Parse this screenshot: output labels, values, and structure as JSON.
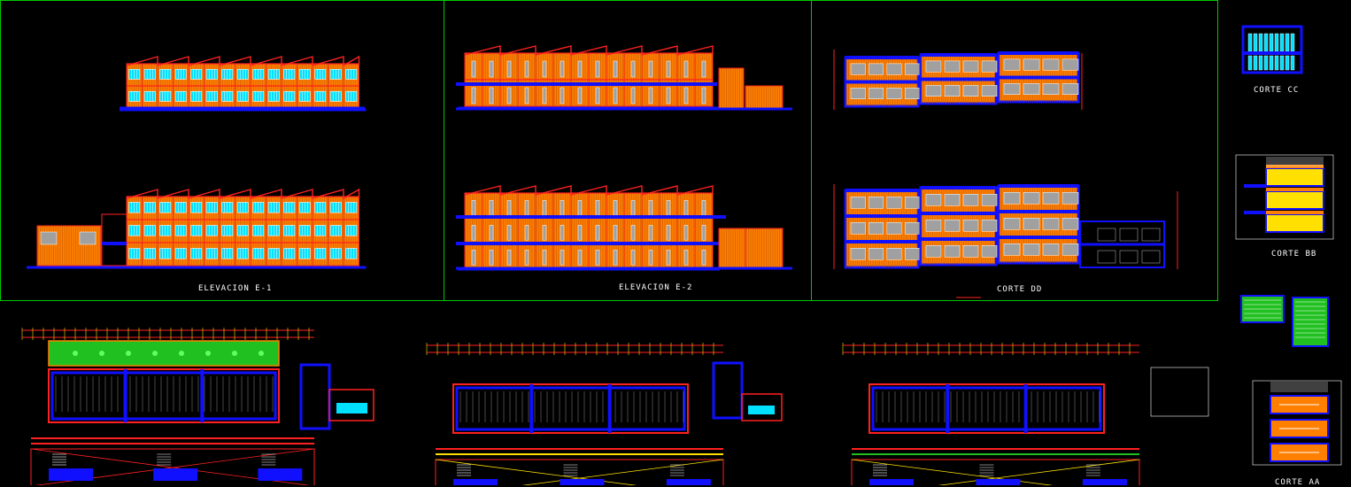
{
  "labels": {
    "elev_e1": "ELEVACION E-1",
    "elev_e2": "ELEVACION E-2",
    "corte_dd": "CORTE DD",
    "corte_cc": "CORTE CC",
    "corte_bb": "CORTE BB",
    "corte_aa": "CORTE AA"
  },
  "colors": {
    "background": "#000000",
    "frame": "#00c800",
    "wall": "#ff7f00",
    "outline": "#ff2020",
    "blue": "#1010ff",
    "cyan": "#00e0ff",
    "white": "#ffffff",
    "green": "#20c020",
    "yellow": "#ffe000",
    "grey": "#a0a0a0"
  }
}
